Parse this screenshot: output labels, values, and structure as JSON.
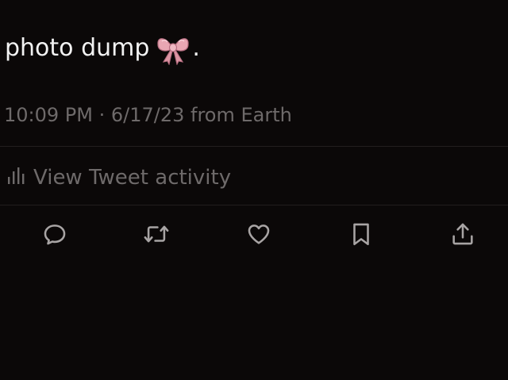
{
  "tweet": {
    "text": "photo dump",
    "emoji_icon": "ribbon-bow-icon",
    "trailing_punctuation": ".",
    "meta": "10:09 PM · 6/17/23 from Earth"
  },
  "activity": {
    "label": "View Tweet activity",
    "icon": "bar-chart-icon"
  },
  "actions": [
    {
      "name": "reply",
      "icon": "reply-icon"
    },
    {
      "name": "retweet",
      "icon": "retweet-icon"
    },
    {
      "name": "like",
      "icon": "heart-icon"
    },
    {
      "name": "bookmark",
      "icon": "bookmark-icon"
    },
    {
      "name": "share",
      "icon": "share-icon"
    }
  ],
  "colors": {
    "background": "#0b0808",
    "primary_text": "#f2f2f2",
    "secondary_text": "#6e6a6a",
    "bow_pink": "#e8a6b3"
  }
}
